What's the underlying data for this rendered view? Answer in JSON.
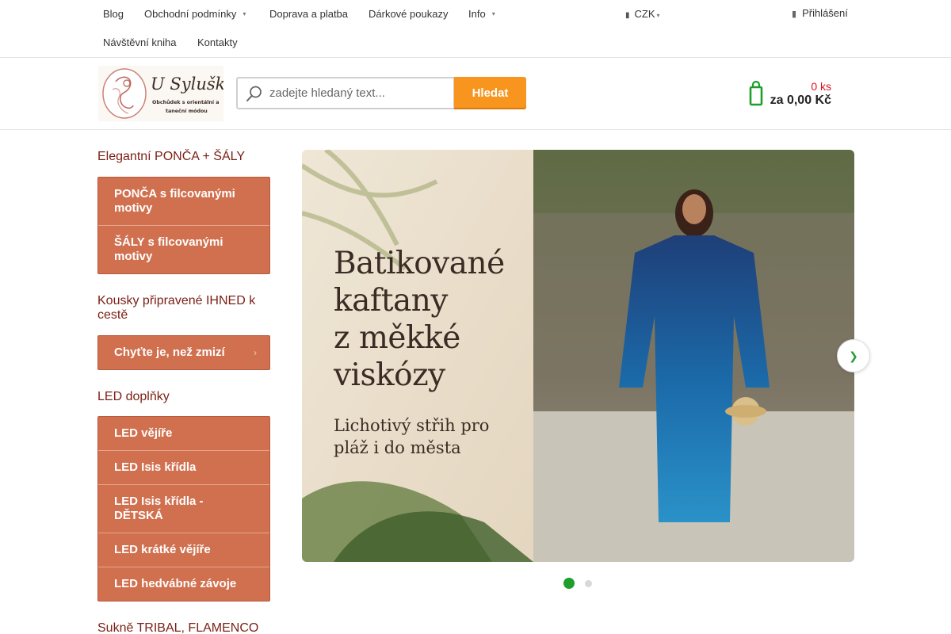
{
  "topnav": {
    "items": [
      {
        "label": "Blog",
        "has_dropdown": false
      },
      {
        "label": "Obchodní podmínky",
        "has_dropdown": true
      },
      {
        "label": "Doprava a platba",
        "has_dropdown": false
      },
      {
        "label": "Dárkové poukazy",
        "has_dropdown": false
      },
      {
        "label": "Info",
        "has_dropdown": true
      },
      {
        "label": "Návštěvní kniha",
        "has_dropdown": false
      },
      {
        "label": "Kontakty",
        "has_dropdown": false
      }
    ],
    "currency": "CZK",
    "login": "Přihlášení"
  },
  "header": {
    "logo_text": "U Sylušky",
    "logo_tagline_1": "Obchůdek s orientální a",
    "logo_tagline_2": "taneční módou",
    "search": {
      "placeholder": "zadejte hledaný text...",
      "value": "",
      "button": "Hledat"
    },
    "cart": {
      "quantity": "0 ks",
      "total": "za 0,00 Kč"
    }
  },
  "sidebar": {
    "sections": [
      {
        "title": "Elegantní PONČA + ŠÁLY",
        "items": [
          {
            "label": "PONČA s filcovanými motivy",
            "has_submenu": false
          },
          {
            "label": "ŠÁLY s filcovanými motivy",
            "has_submenu": false
          }
        ]
      },
      {
        "title": "Kousky připravené IHNED k cestě",
        "items": [
          {
            "label": "Chyťte je, než zmizí",
            "has_submenu": true
          }
        ]
      },
      {
        "title": "LED doplňky",
        "items": [
          {
            "label": "LED vějíře",
            "has_submenu": false
          },
          {
            "label": "LED Isis křídla",
            "has_submenu": false
          },
          {
            "label": "LED Isis křídla - DĚTSKÁ",
            "has_submenu": false
          },
          {
            "label": "LED krátké vějíře",
            "has_submenu": false
          },
          {
            "label": "LED hedvábné závoje",
            "has_submenu": false
          }
        ]
      },
      {
        "title": "Sukně TRIBAL, FLAMENCO",
        "items": []
      }
    ]
  },
  "banner": {
    "headline_lines": [
      "Batikované",
      "kaftany",
      "z měkké",
      "viskózy"
    ],
    "sub_lines": [
      "Lichotivý střih pro",
      "pláž i do města"
    ],
    "slides_total": 2,
    "active_slide": 1
  },
  "colors": {
    "accent_orange": "#f7951e",
    "menu_bg": "#d0704f",
    "category_title": "#7a1f14",
    "cart_icon": "#1e9f2c",
    "slider_active_dot": "#1e9f2c"
  },
  "icons": {
    "currency": "credit-card-icon",
    "login": "user-icon",
    "search": "magnifier-icon",
    "cart": "cart-icon",
    "next": "chevron-right-icon",
    "submenu": "chevron-right-icon",
    "dropdown": "caret-down-icon"
  }
}
